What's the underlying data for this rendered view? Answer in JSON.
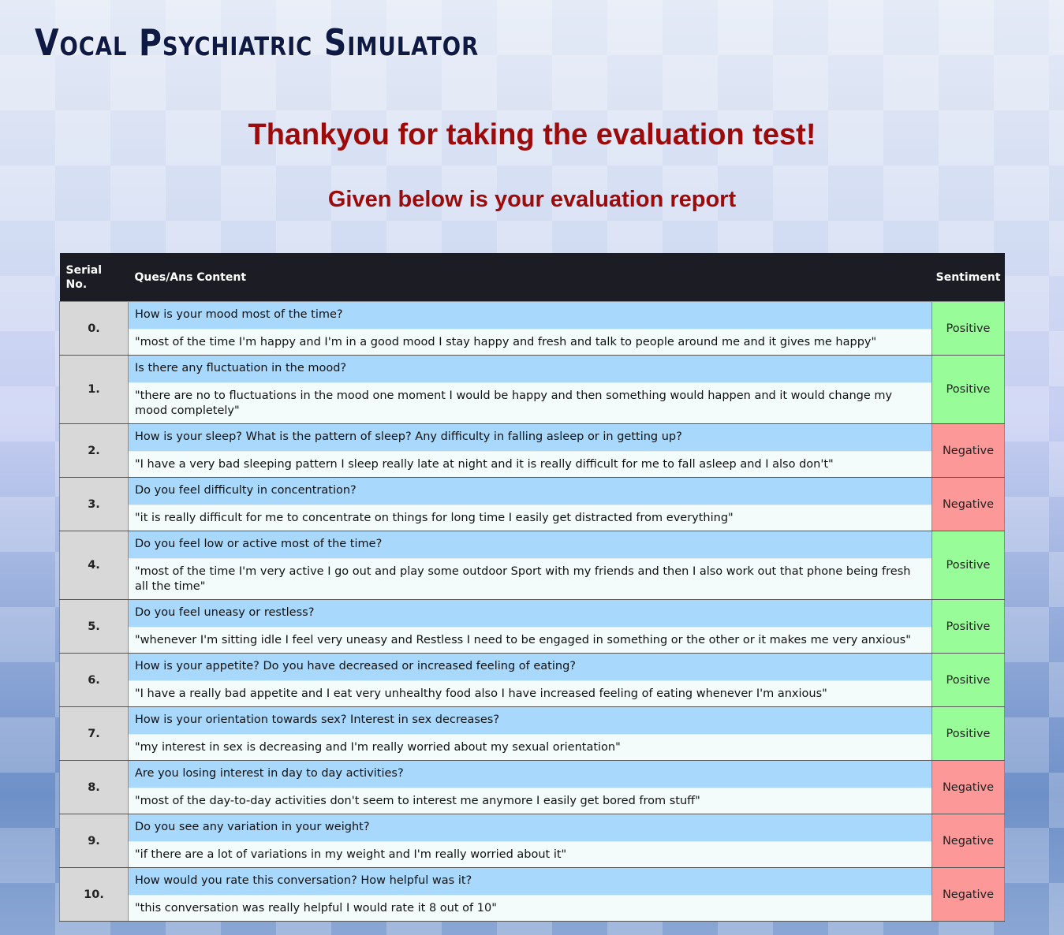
{
  "brand": {
    "title": "Vocal Psychiatric Simulator"
  },
  "headline": "Thankyou for taking the evaluation test!",
  "subheadline": "Given below is your evaluation report",
  "colors": {
    "headline": "#9c0a0a",
    "header_bg": "#1c1d24",
    "question_bg": "#a8d8fc",
    "answer_bg": "#f3fbfb",
    "positive": "#98fc98",
    "negative": "#fc9898"
  },
  "table": {
    "headers": {
      "serial": "Serial No.",
      "content": "Ques/Ans Content",
      "sentiment": "Sentiment"
    },
    "rows": [
      {
        "serial": "0.",
        "question": "How is your mood most of the time?",
        "answer": "\"most of the time I'm happy and I'm in a good mood I stay happy and fresh and talk to people around me and it gives me happy\"",
        "sentiment": "Positive"
      },
      {
        "serial": "1.",
        "question": "Is there any fluctuation in the mood?",
        "answer": "\"there are no to fluctuations in the mood one moment I would be happy and then something would happen and it would change my mood completely\"",
        "sentiment": "Positive"
      },
      {
        "serial": "2.",
        "question": "How is your sleep? What is the pattern of sleep? Any difficulty in falling asleep or in getting up?",
        "answer": "\"I have a very bad sleeping pattern I sleep really late at night and it is really difficult for me to fall asleep and I also don't\"",
        "sentiment": "Negative"
      },
      {
        "serial": "3.",
        "question": "Do you feel difficulty in concentration?",
        "answer": "\"it is really difficult for me to concentrate on things for long time I easily get distracted from everything\"",
        "sentiment": "Negative"
      },
      {
        "serial": "4.",
        "question": "Do you feel low or active most of the time?",
        "answer": "\"most of the time I'm very active I go out and play some outdoor Sport with my friends and then I also work out that phone being fresh all the time\"",
        "sentiment": "Positive"
      },
      {
        "serial": "5.",
        "question": "Do you feel uneasy or restless?",
        "answer": "\"whenever I'm sitting idle I feel very uneasy and Restless I need to be engaged in something or the other or it makes me very anxious\"",
        "sentiment": "Positive"
      },
      {
        "serial": "6.",
        "question": "How is your appetite? Do you have decreased or increased feeling of eating?",
        "answer": "\"I have a really bad appetite and I eat very unhealthy food also I have increased feeling of eating whenever I'm anxious\"",
        "sentiment": "Positive"
      },
      {
        "serial": "7.",
        "question": "How is your orientation towards sex? Interest in sex decreases?",
        "answer": "\"my interest in sex is decreasing and I'm really worried about my sexual orientation\"",
        "sentiment": "Positive"
      },
      {
        "serial": "8.",
        "question": "Are you losing interest in day to day activities?",
        "answer": "\"most of the day-to-day activities don't seem to interest me anymore I easily get bored from stuff\"",
        "sentiment": "Negative"
      },
      {
        "serial": "9.",
        "question": "Do you see any variation in your weight?",
        "answer": "\"if there are a lot of variations in my weight and I'm really worried about it\"",
        "sentiment": "Negative"
      },
      {
        "serial": "10.",
        "question": "How would you rate this conversation? How helpful was it?",
        "answer": "\"this conversation was really helpful I would rate it 8 out of 10\"",
        "sentiment": "Negative"
      }
    ]
  }
}
